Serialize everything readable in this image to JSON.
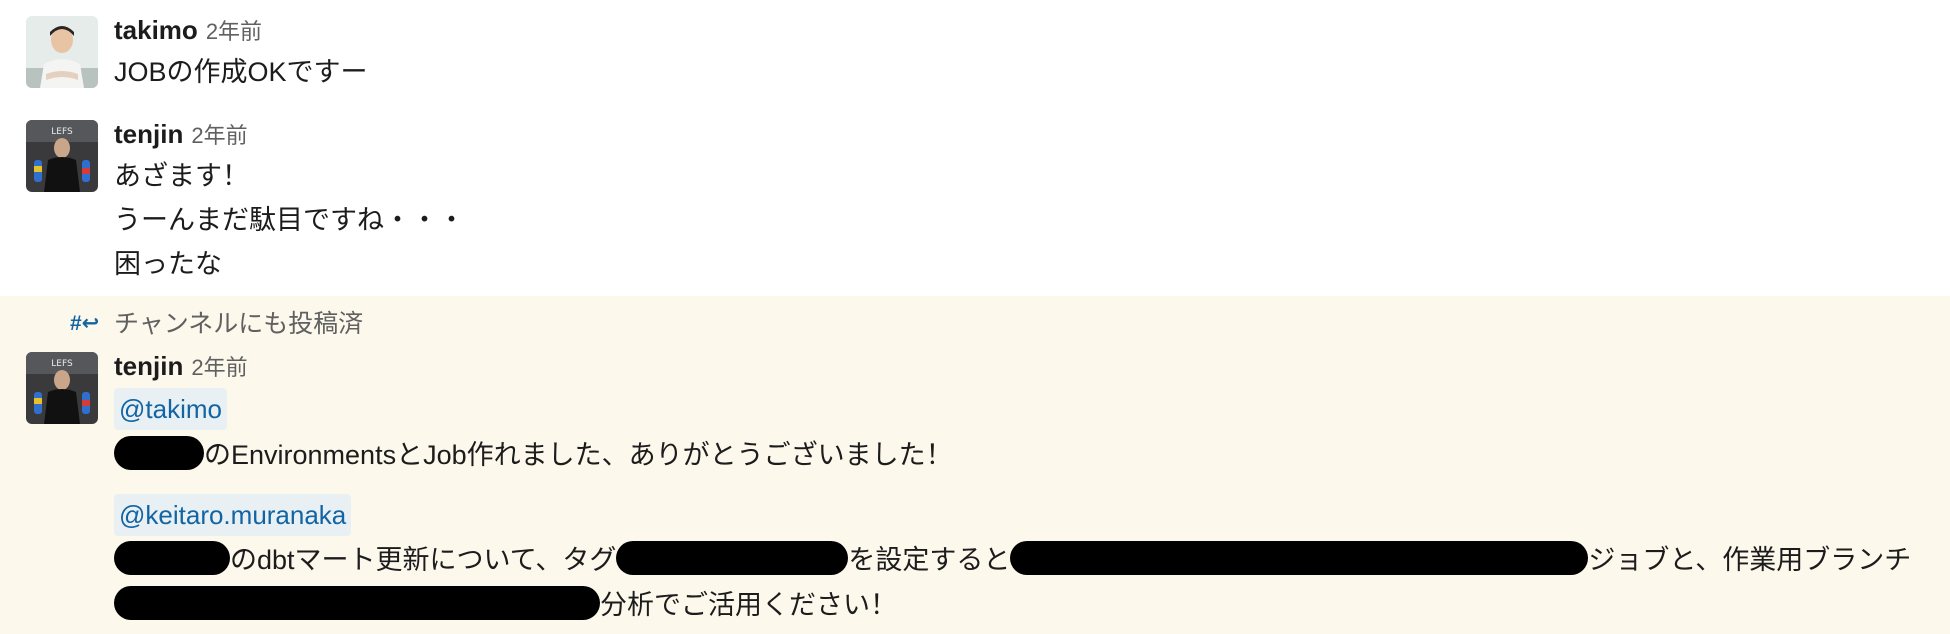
{
  "messages": [
    {
      "user": "takimo",
      "time": "2年前",
      "lines": [
        "JOBの作成OKですー"
      ]
    },
    {
      "user": "tenjin",
      "time": "2年前",
      "lines": [
        "あざます！",
        "うーんまだ駄目ですね・・・",
        "困ったな"
      ]
    }
  ],
  "thread_notice": {
    "icon": "#↩",
    "text": "チャンネルにも投稿済"
  },
  "reply": {
    "user": "tenjin",
    "time": "2年前",
    "mention1": "@takimo",
    "line1_text": "のEnvironmentsとJob作れました、ありがとうございました！",
    "mention2": "@keitaro.muranaka",
    "line2_part1": "のdbtマート更新について、タグ",
    "line2_part2": "を設定すると",
    "line2_part3": "ジョブと、作業用ブランチ",
    "line3_text": "分析でご活用ください！"
  },
  "colors": {
    "highlight_background": "#fcf8ec",
    "mention_text": "#1264a3",
    "mention_background": "#e8f0f4",
    "redaction": "#000000"
  }
}
